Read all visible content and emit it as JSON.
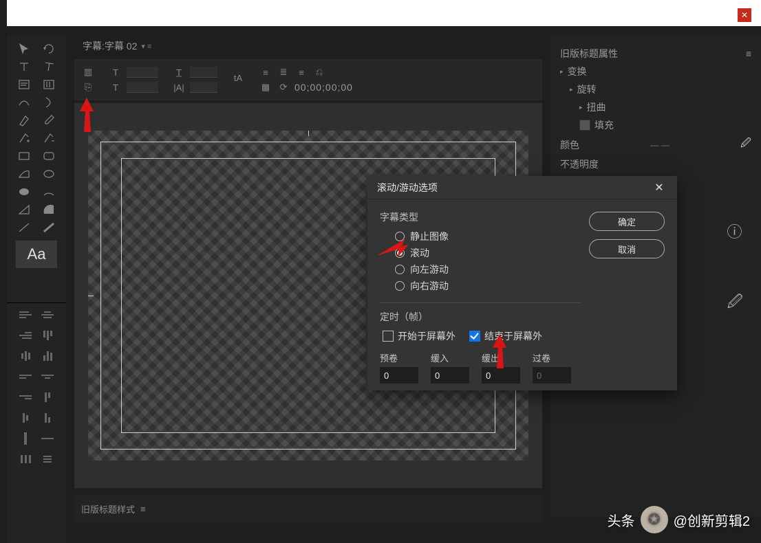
{
  "top": {
    "close_x": "✕"
  },
  "tabs": {
    "title": "字幕:字幕 02",
    "menu": "▾ ≡"
  },
  "optbar": {
    "timecode": "00;00;00;00"
  },
  "tools": {
    "aa": "Aa"
  },
  "props": {
    "title": "旧版标题属性",
    "items": {
      "transform": "变换",
      "rotate": "旋转",
      "distort": "扭曲",
      "fill": "填充",
      "fill_color": "颜色",
      "opacity": "不透明度"
    },
    "eyedrop_tip": "🖉"
  },
  "bottom": {
    "label": "旧版标题样式",
    "menu": "≡"
  },
  "modal": {
    "title": "滚动/游动选项",
    "close": "✕",
    "ok": "确定",
    "cancel": "取消",
    "group1": "字幕类型",
    "radios": {
      "still": "静止图像",
      "roll": "滚动",
      "crawl_left": "向左游动",
      "crawl_right": "向右游动"
    },
    "group2": "定时（帧）",
    "chk_start": "开始于屏幕外",
    "chk_end": "结束于屏幕外",
    "cols": {
      "preroll": "预卷",
      "easein": "缓入",
      "easeout": "缓出",
      "postroll": "过卷"
    },
    "vals": {
      "preroll": "0",
      "easein": "0",
      "easeout": "0",
      "postroll": "0"
    }
  },
  "watermark": {
    "brand": "头条",
    "avatar": "✪",
    "user": "@创新剪辑2"
  }
}
